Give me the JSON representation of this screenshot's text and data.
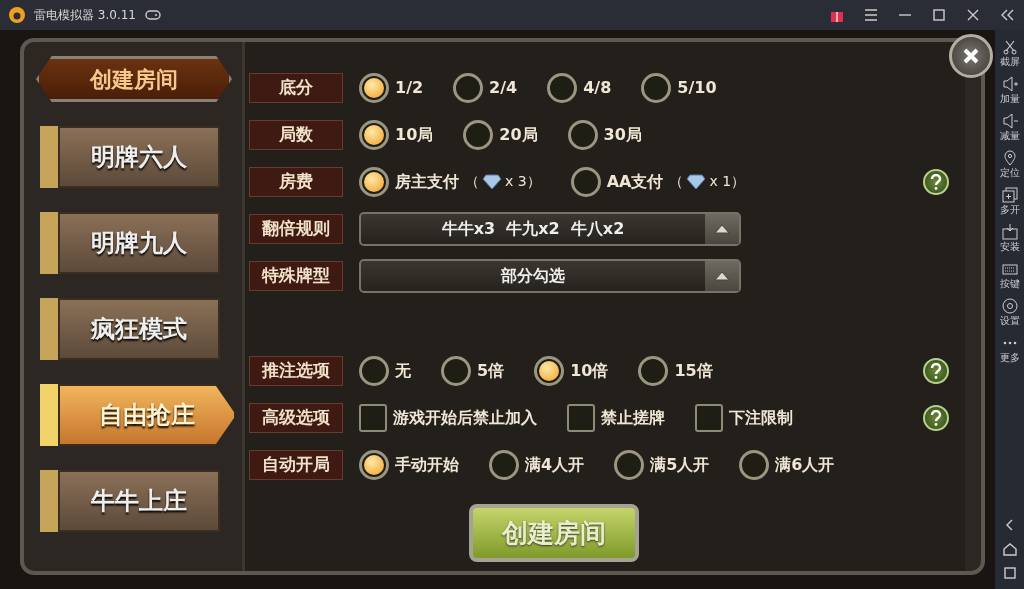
{
  "window": {
    "title": "雷电模拟器 3.0.11"
  },
  "side_toolbar": [
    {
      "label": "截屏"
    },
    {
      "label": "加量"
    },
    {
      "label": "减量"
    },
    {
      "label": "定位"
    },
    {
      "label": "多开"
    },
    {
      "label": "安装"
    },
    {
      "label": "按键"
    },
    {
      "label": "设置"
    },
    {
      "label": "更多"
    }
  ],
  "header": {
    "title": "创建房间"
  },
  "modes": [
    {
      "label": "明牌六人",
      "selected": false
    },
    {
      "label": "明牌九人",
      "selected": false
    },
    {
      "label": "疯狂模式",
      "selected": false
    },
    {
      "label": "自由抢庄",
      "selected": true
    },
    {
      "label": "牛牛上庄",
      "selected": false
    }
  ],
  "settings": [
    {
      "label": "底分",
      "kind": "radio",
      "help": false,
      "options": [
        {
          "label": "1/2",
          "selected": true
        },
        {
          "label": "2/4",
          "selected": false
        },
        {
          "label": "4/8",
          "selected": false
        },
        {
          "label": "5/10",
          "selected": false
        }
      ]
    },
    {
      "label": "局数",
      "kind": "radio",
      "help": false,
      "options": [
        {
          "label": "10局",
          "selected": true
        },
        {
          "label": "20局",
          "selected": false
        },
        {
          "label": "30局",
          "selected": false
        }
      ]
    },
    {
      "label": "房费",
      "kind": "radio",
      "help": true,
      "options": [
        {
          "label": "房主支付",
          "cost_open": "（",
          "cost": "x 3）",
          "selected": true
        },
        {
          "label": "AA支付",
          "cost_open": "（",
          "cost": "x 1）",
          "selected": false
        }
      ]
    },
    {
      "label": "翻倍规则",
      "kind": "dropdown",
      "help": false,
      "value": "牛牛x3  牛九x2  牛八x2"
    },
    {
      "label": "特殊牌型",
      "kind": "dropdown",
      "help": false,
      "value": "部分勾选"
    },
    {
      "label": "推注选项",
      "kind": "radio",
      "help": true,
      "options": [
        {
          "label": "无",
          "selected": false
        },
        {
          "label": "5倍",
          "selected": false
        },
        {
          "label": "10倍",
          "selected": true
        },
        {
          "label": "15倍",
          "selected": false
        }
      ]
    },
    {
      "label": "高级选项",
      "kind": "checkbox",
      "help": true,
      "options": [
        {
          "label": "游戏开始后禁止加入",
          "checked": false
        },
        {
          "label": "禁止搓牌",
          "checked": false
        },
        {
          "label": "下注限制",
          "checked": false
        }
      ]
    },
    {
      "label": "自动开局",
      "kind": "radio",
      "help": false,
      "options": [
        {
          "label": "手动开始",
          "selected": true
        },
        {
          "label": "满4人开",
          "selected": false
        },
        {
          "label": "满5人开",
          "selected": false
        },
        {
          "label": "满6人开",
          "selected": false
        }
      ]
    }
  ],
  "create_button": {
    "label": "创建房间"
  }
}
